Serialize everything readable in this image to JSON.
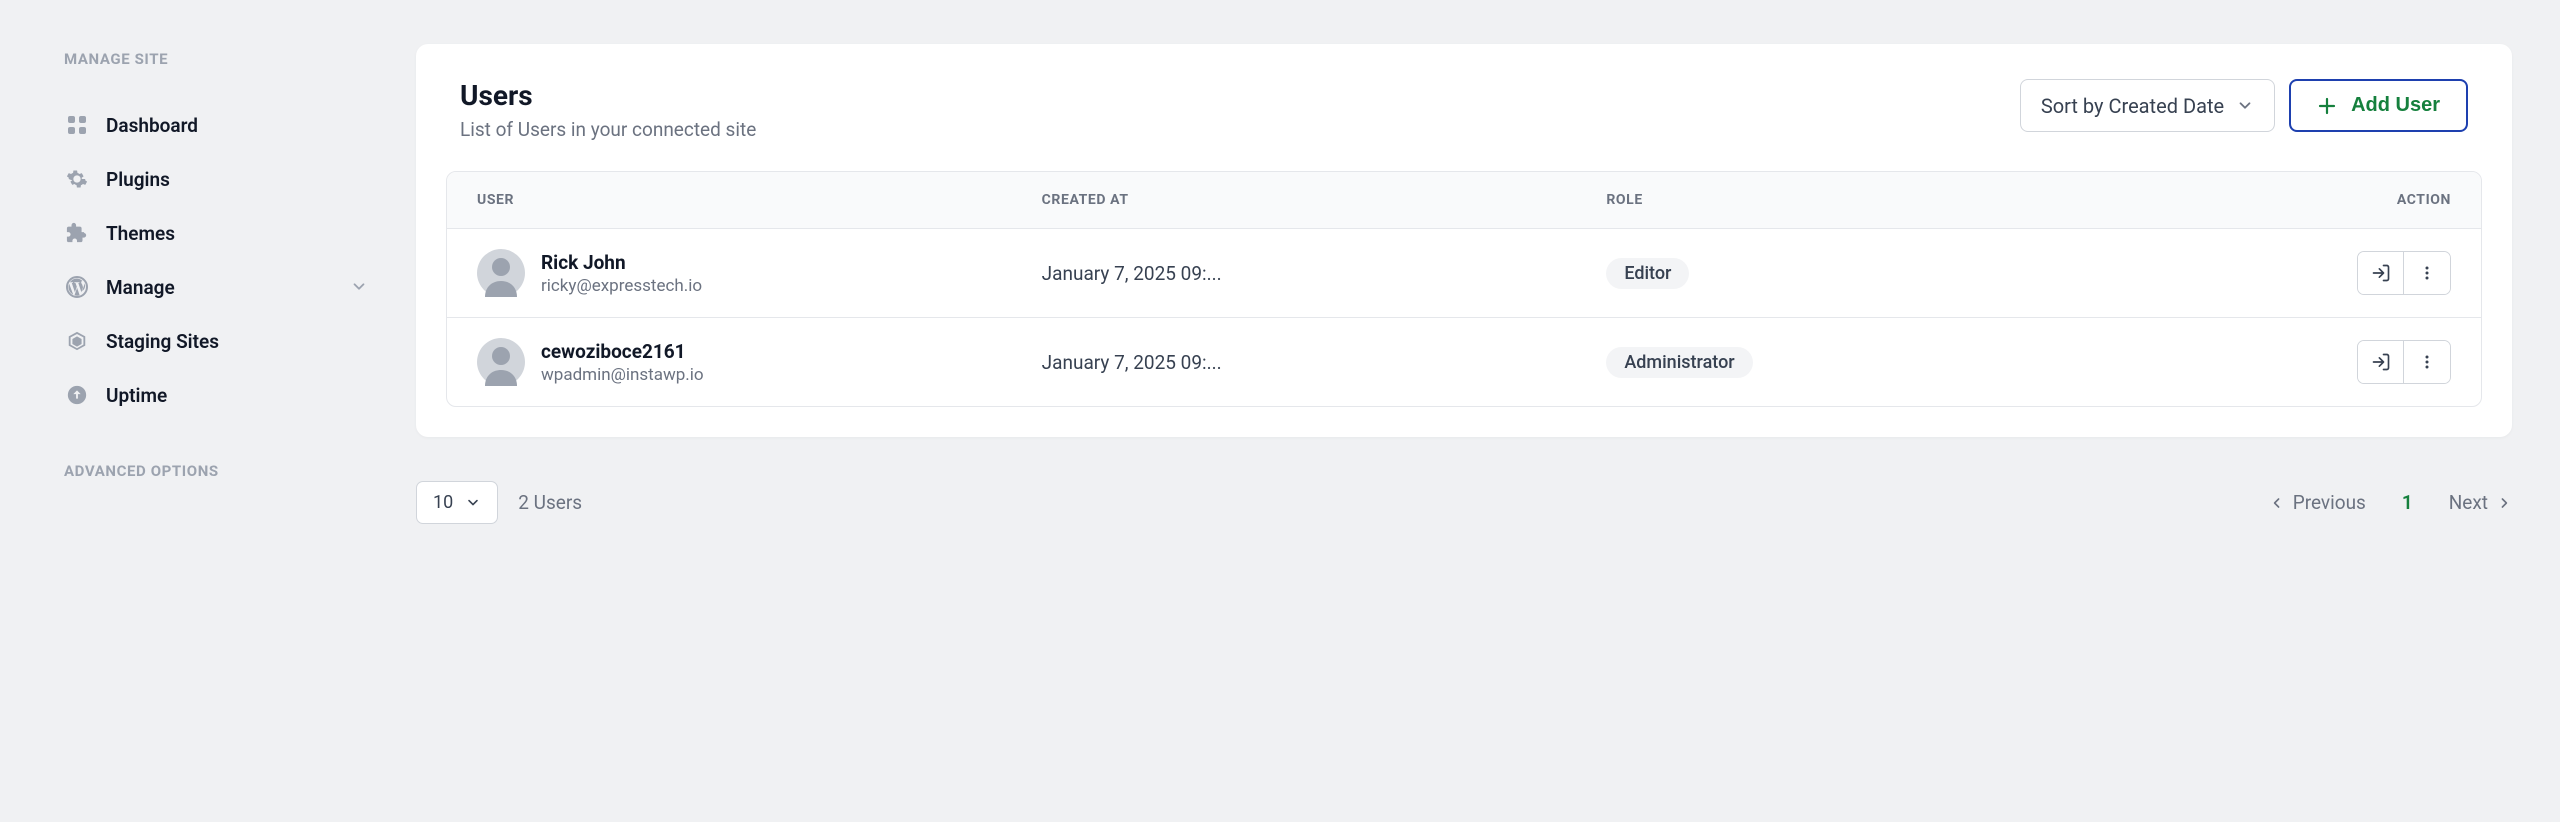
{
  "sidebar": {
    "sections": {
      "manage_site": {
        "title": "MANAGE SITE",
        "items": [
          {
            "id": "dashboard",
            "label": "Dashboard",
            "icon": "grid-icon"
          },
          {
            "id": "plugins",
            "label": "Plugins",
            "icon": "gear-icon"
          },
          {
            "id": "themes",
            "label": "Themes",
            "icon": "puzzle-icon"
          },
          {
            "id": "manage",
            "label": "Manage",
            "icon": "wordpress-icon",
            "expandable": true
          },
          {
            "id": "staging",
            "label": "Staging Sites",
            "icon": "cube-icon"
          },
          {
            "id": "uptime",
            "label": "Uptime",
            "icon": "arrow-up-circle-icon"
          }
        ]
      },
      "advanced": {
        "title": "ADVANCED OPTIONS"
      }
    }
  },
  "header": {
    "title": "Users",
    "subtitle": "List of Users in your connected site",
    "sort_label": "Sort by Created Date",
    "add_user_label": "Add User"
  },
  "table": {
    "columns": {
      "user": "USER",
      "created_at": "CREATED AT",
      "role": "ROLE",
      "action": "ACTION"
    },
    "rows": [
      {
        "name": "Rick John",
        "email": "ricky@expresstech.io",
        "created_at": "January 7, 2025 09:...",
        "role": "Editor"
      },
      {
        "name": "cewoziboce2161",
        "email": "wpadmin@instawp.io",
        "created_at": "January 7, 2025 09:...",
        "role": "Administrator"
      }
    ]
  },
  "pagination": {
    "page_size": "10",
    "total_label": "2 Users",
    "previous_label": "Previous",
    "next_label": "Next",
    "current_page": "1"
  },
  "colors": {
    "accent_green": "#15803d",
    "accent_blue": "#1e40af"
  }
}
